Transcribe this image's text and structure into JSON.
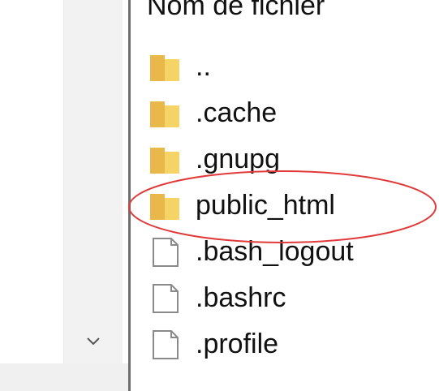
{
  "file_list": {
    "column_header": "Nom de fichier",
    "items": [
      {
        "name": "..",
        "type": "folder"
      },
      {
        "name": ".cache",
        "type": "folder"
      },
      {
        "name": ".gnupg",
        "type": "folder"
      },
      {
        "name": "public_html",
        "type": "folder"
      },
      {
        "name": ".bash_logout",
        "type": "file"
      },
      {
        "name": ".bashrc",
        "type": "file"
      },
      {
        "name": ".profile",
        "type": "file"
      }
    ]
  },
  "icons": {
    "folder": "folder-icon",
    "file": "file-icon",
    "scroll_down": "chevron-down-icon"
  },
  "colors": {
    "folder": "#f6d365",
    "folder_dark": "#e8b84a",
    "file_border": "#8a8a8a",
    "highlight": "#e03a3a",
    "divider": "#6e6e6e"
  }
}
